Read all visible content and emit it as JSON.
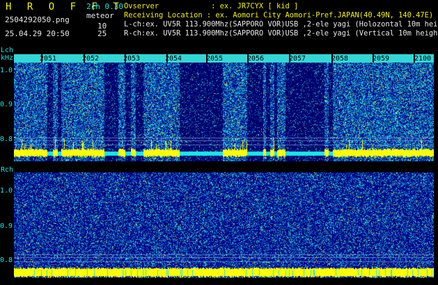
{
  "header": {
    "app_title": "H R O F F T",
    "mode": "2ch 0.30",
    "meteor_label": "meteor",
    "count_l": "10",
    "count_r": "25",
    "filename": "2504292050.png",
    "timestamp": "25.04.29 20:50"
  },
  "info": {
    "observer": "Ovserver            : ex. JR7CYX [ kid ]",
    "location": "Receiving Location : ex. Aomori City Aomori-Pref.JAPAN(40.49N, 140.47E)",
    "lch": "L-ch:ex. UV5R 113.900Mhz(SAPPORO VOR)USB ,2-ele yagi (Holozontal 10m height)",
    "rch": "R-ch:ex. UV5R 113.900Mhz(SAPPORO VOR)USB ,2-ele yagi (Vertical 10m height)"
  },
  "axes": {
    "lch_label": "Lch",
    "khz_label": "kHz",
    "rch_label": "Rch",
    "lch_ticks": [
      "1.0",
      "0.9",
      "0.8"
    ],
    "rch_ticks": [
      "1.0",
      "0.9",
      "0.8"
    ]
  },
  "hours": [
    "2051",
    "2052",
    "2053",
    "2054",
    "2055",
    "2056",
    "2057",
    "2058",
    "2059",
    "2100"
  ],
  "colors": {
    "background": "#000000",
    "text_cyan": "#19e6e6",
    "text_yellow": "#f2f200",
    "hour_bar": "#33d6d6",
    "trace_yellow": "#ffff00"
  }
}
